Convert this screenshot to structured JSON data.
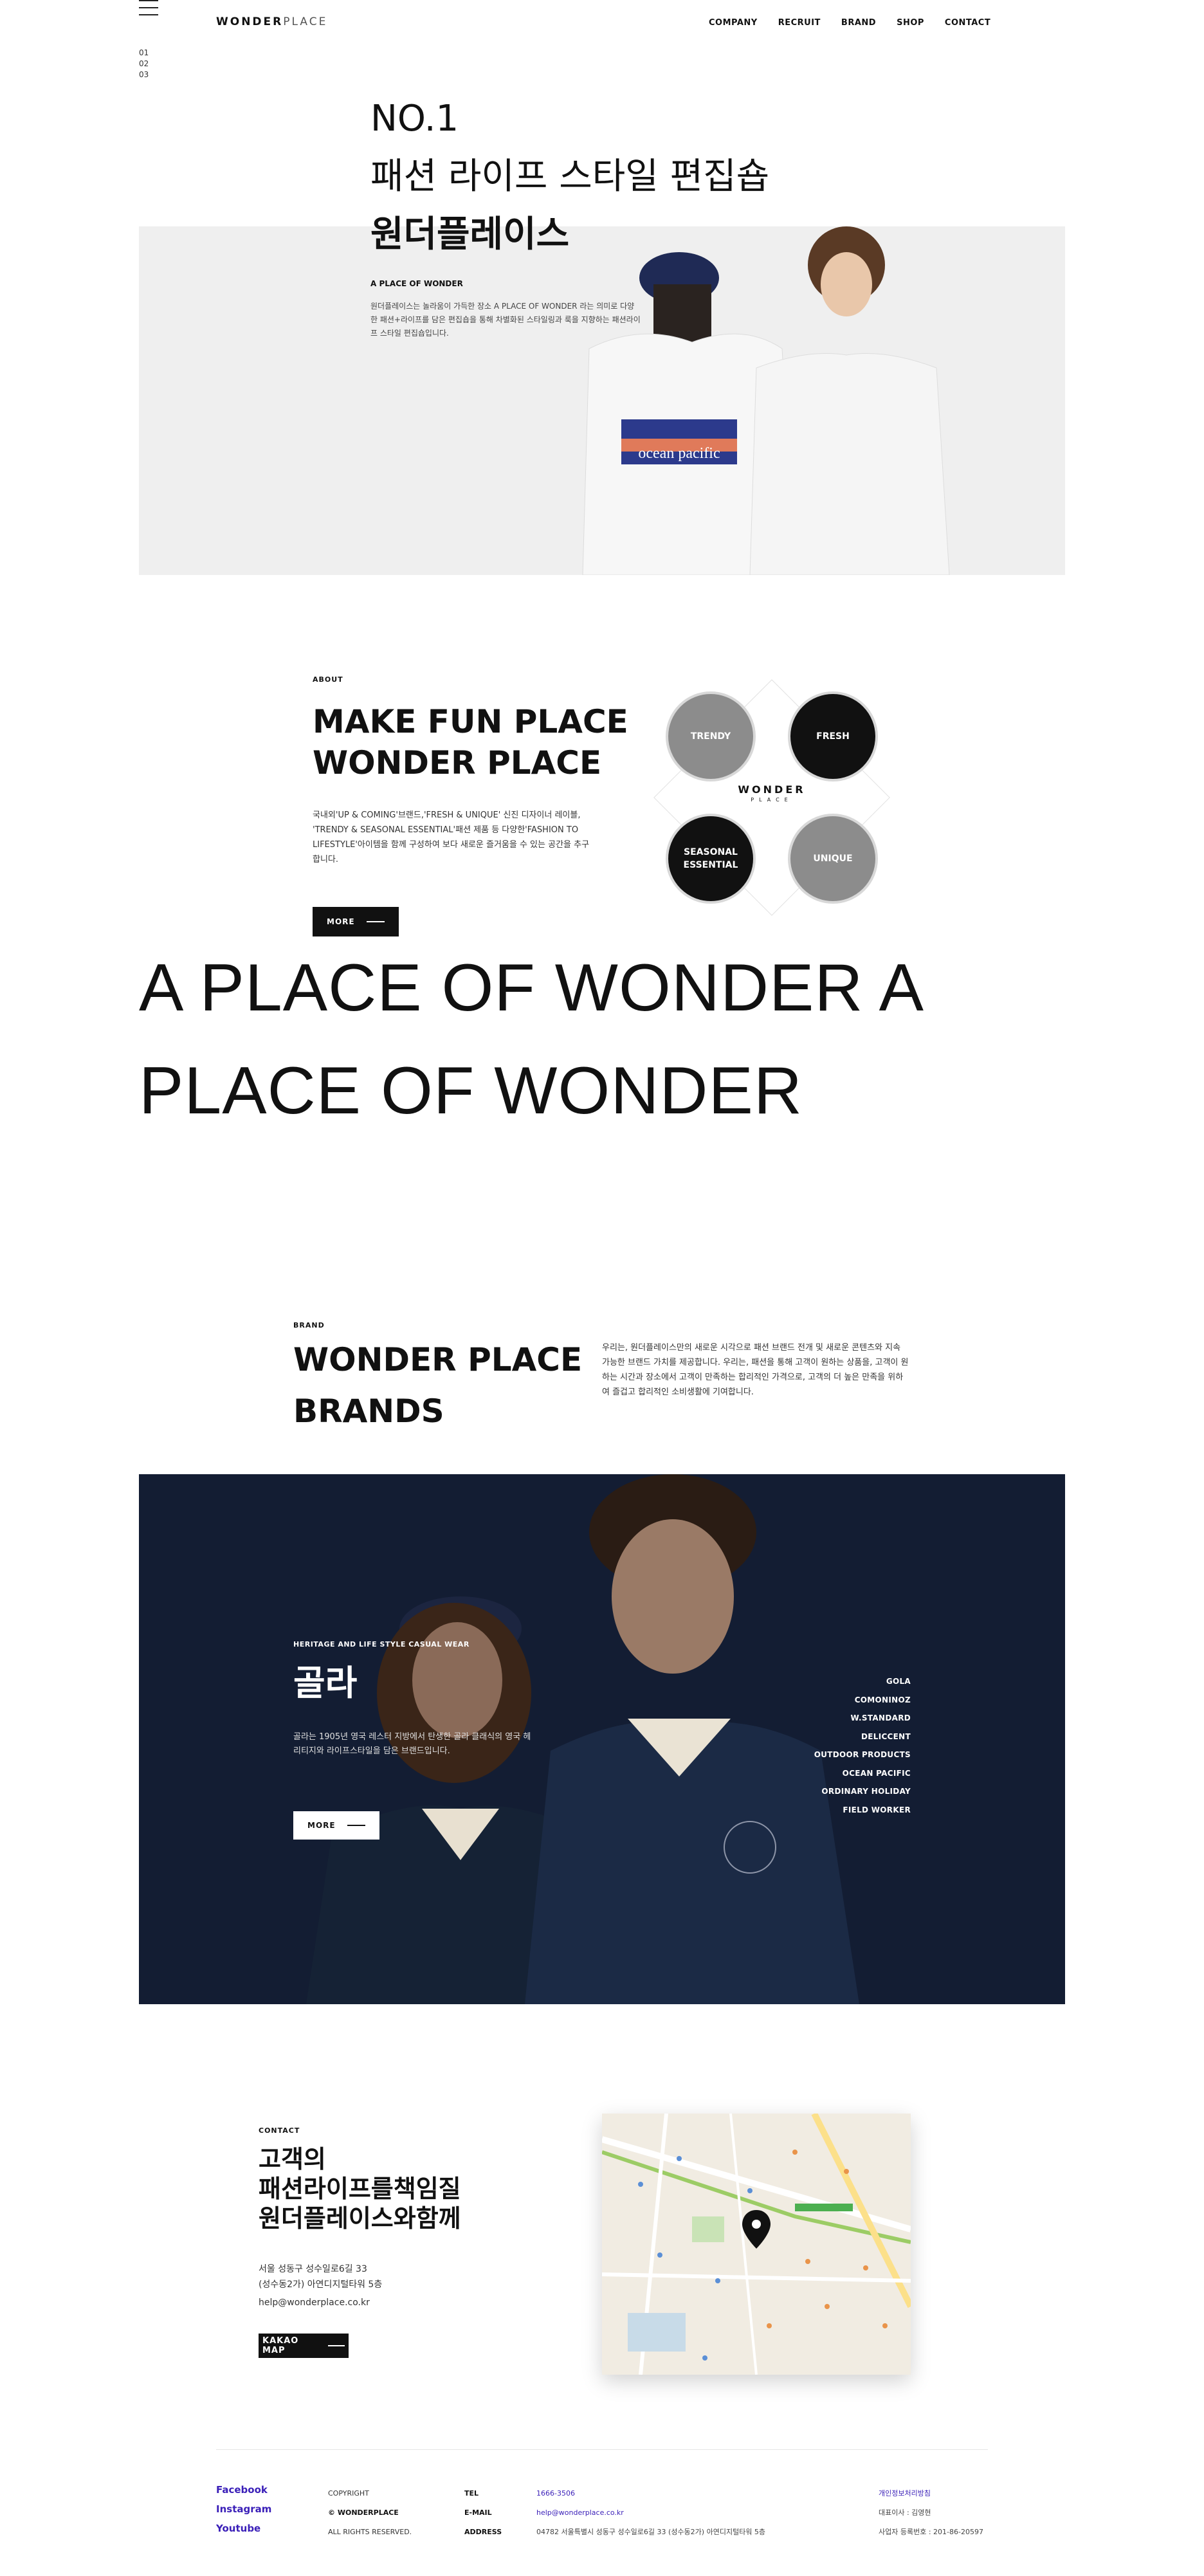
{
  "header": {
    "logo_bold": "WONDER",
    "logo_thin": "PLACE",
    "nav": [
      "COMPANY",
      "RECRUIT",
      "BRAND",
      "SHOP",
      "CONTACT"
    ],
    "pager": [
      "01",
      "02",
      "03"
    ]
  },
  "hero": {
    "line1": "NO.1",
    "line2": "패션 라이프 스타일 편집숍",
    "line3": "원더플레이스",
    "sub": "A PLACE OF WONDER",
    "desc": "원더플레이스는 놀라움이 가득한 장소 A PLACE OF WONDER 라는 의미로 다양한 패션+라이프를 담은 편집숍을 통해 차별화된 스타일링과 룩을 지향하는 패션라이프 스타일 편집숍입니다."
  },
  "about": {
    "label": "ABOUT",
    "title": "MAKE FUN PLACE WONDER PLACE",
    "desc": "국내외'UP & COMING'브랜드,'FRESH & UNIQUE' 신진 디자이너 레이블, 'TRENDY & SEASONAL ESSENTIAL'패션 제품 등 다양한'FASHION TO LIFESTYLE'아이템을 함께 구성하여 보다 새로운 즐거움을 수 있는 공간을 추구 합니다.",
    "more": "MORE",
    "circles": [
      "TRENDY",
      "FRESH",
      "SEASONAL ESSENTIAL",
      "UNIQUE"
    ],
    "center_logo": "WONDER",
    "center_logo_sub": "PLACE"
  },
  "marquee": {
    "text": "A PLACE OF WONDER A PLACE OF WONDER"
  },
  "brand": {
    "label": "BRAND",
    "title_line1": "WONDER PLACE",
    "title_line2": "BRANDS",
    "desc": "우리는, 원더플레이스만의 새로운 시각으로 패션 브랜드 전개 및 새로운 콘텐츠와 지속 가능한 브랜드 가치를 제공합니다. 우리는, 패션을 통해 고객이 원하는 상품을, 고객이 원하는 시간과 장소에서 고객이 만족하는 합리적인 가격으로, 고객의 더 높은 만족을 위하여 즐겁고 합리적인 소비생활에 기여합니다.",
    "featured": {
      "sub": "HERITAGE AND LIFE STYLE CASUAL WEAR",
      "name": "골라",
      "desc": "골라는 1905년 영국 레스터 지방에서 탄생한 골라 클래식의 영국 헤리티지와 라이프스타일을 담은 브랜드입니다.",
      "more": "MORE"
    },
    "list": [
      "GOLA",
      "COMONINOZ",
      "W.STANDARD",
      "DELICCENT",
      "OUTDOOR PRODUCTS",
      "OCEAN PACIFIC",
      "ORDINARY HOLIDAY",
      "FIELD WORKER"
    ]
  },
  "contact": {
    "label": "CONTACT",
    "title": [
      "고객의",
      "패션라이프를책임질",
      "원더플레이스와함께"
    ],
    "address_line1": "서울 성동구 성수일로6길 33",
    "address_line2": "(성수동2가) 아연디지털타워 5층",
    "email": "help@wonderplace.co.kr",
    "kakao": "KAKAO MAP"
  },
  "footer": {
    "sns": [
      "Facebook",
      "Instagram",
      "Youtube"
    ],
    "copyright_label": "COPYRIGHT",
    "copyright_company": "© WONDERPLACE",
    "copyright_rights": "ALL RIGHTS RESERVED.",
    "tel_label": "TEL",
    "tel": "1666-3506",
    "email_label": "E-MAIL",
    "email": "help@wonderplace.co.kr",
    "address_label": "ADDRESS",
    "address": "04782 서울특별시 성동구 성수일로6길 33 (성수동2가) 아연디지털타워 5층",
    "privacy": "개인정보처리방침",
    "ceo": "대표이사 : 김영현",
    "bizno": "사업자 등록번호 : 201-86-20597"
  },
  "colors": {
    "accent": "#3a1fb8",
    "dark": "#111111",
    "brand_bg": "#16213a"
  }
}
